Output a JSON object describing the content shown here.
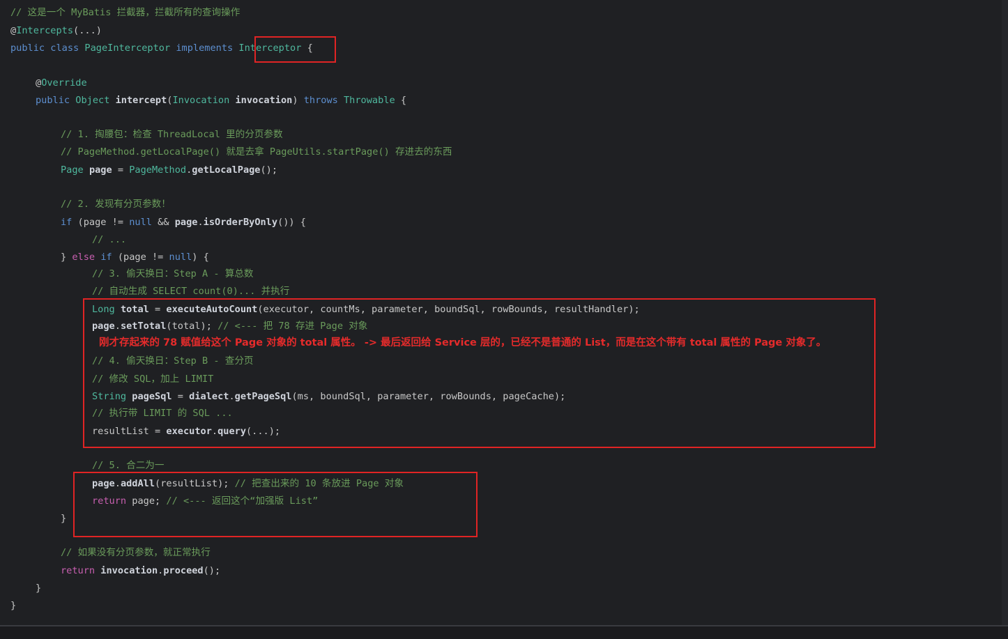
{
  "code": {
    "l1": [
      "// 这是一个 MyBatis 拦截器，拦截所有的查询操作"
    ],
    "l2": [
      "@",
      "Intercepts",
      "(...)"
    ],
    "l3": [
      "public class ",
      "PageInterceptor",
      " implements ",
      "Interceptor",
      " {"
    ],
    "l4": [
      "@",
      "Override"
    ],
    "l5": [
      "public ",
      "Object",
      " ",
      "intercept",
      "(",
      "Invocation",
      " ",
      "invocation",
      ") ",
      "throws",
      " ",
      "Throwable",
      " {"
    ],
    "l6": [
      "// 1. 掏腰包：检查 ThreadLocal 里的分页参数"
    ],
    "l7": [
      "// PageMethod.getLocalPage() 就是去拿 PageUtils.startPage() 存进去的东西"
    ],
    "l8": [
      "Page",
      " ",
      "page",
      " = ",
      "PageMethod",
      ".",
      "getLocalPage",
      "();"
    ],
    "l9": [
      "// 2. 发现有分页参数！"
    ],
    "l10": [
      "if",
      " (page != ",
      "null",
      " && ",
      "page",
      ".",
      "isOrderByOnly",
      "()) {"
    ],
    "l11": [
      "// ..."
    ],
    "l12": [
      "} ",
      "else",
      " ",
      "if",
      " (page != ",
      "null",
      ") {"
    ],
    "l13": [
      "// 3. 偷天换日：Step A - 算总数"
    ],
    "l14": [
      "// 自动生成 SELECT count(0)... 并执行"
    ],
    "l15": [
      "Long",
      " ",
      "total",
      " = ",
      "executeAutoCount",
      "(executor, countMs, parameter, boundSql, rowBounds, resultHandler);"
    ],
    "l16": [
      "page",
      ".",
      "setTotal",
      "(total); ",
      "// <--- 把 78 存进 Page 对象"
    ],
    "l17": [
      "// 4. 偷天换日：Step B - 查分页"
    ],
    "l18": [
      "// 修改 SQL，加上 LIMIT"
    ],
    "l19": [
      "String",
      " ",
      "pageSql",
      " = ",
      "dialect",
      ".",
      "getPageSql",
      "(ms, boundSql, parameter, rowBounds, pageCache);"
    ],
    "l20": [
      "// 执行带 LIMIT 的 SQL ..."
    ],
    "l21": [
      "resultList = ",
      "executor",
      ".",
      "query",
      "(...);"
    ],
    "l22": [
      "// 5. 合二为一"
    ],
    "l23": [
      "page",
      ".",
      "addAll",
      "(resultList); ",
      "// 把查出来的 10 条放进 Page 对象"
    ],
    "l24": [
      "return",
      " page; ",
      "// <--- 返回这个“加强版 List”"
    ],
    "l25": [
      "}"
    ],
    "l26": [
      "// 如果没有分页参数，就正常执行"
    ],
    "l27": [
      "return",
      " ",
      "invocation",
      ".",
      "proceed",
      "();"
    ],
    "l28": [
      "}"
    ],
    "l29": [
      "}"
    ]
  },
  "annotation": "刚才存起来的 78 赋值给这个 Page 对象的 total 属性。 -> 最后返回给 Service 层的，已经不是普通的 List，而是在这个带有 total 属性的 Page 对象了。",
  "colors": {
    "background": "#1f2023",
    "highlight_box": "#e02424",
    "annotation_text": "#e52b2b",
    "comment": "#6a9b5b",
    "keyword": "#5d8fd0",
    "type": "#4fb89e"
  }
}
